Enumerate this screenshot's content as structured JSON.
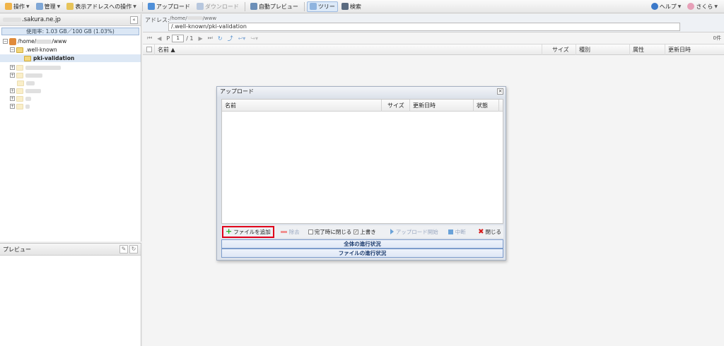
{
  "toolbar": {
    "operations": "操作",
    "manage": "管理",
    "address_ops": "表示アドレスへの操作",
    "upload": "アップロード",
    "download": "ダウンロード",
    "auto_preview": "自動プレビュー",
    "tree": "ツリー",
    "search": "検索",
    "help": "ヘルプ",
    "user": "さくら"
  },
  "left_panel": {
    "domain": ".sakura.ne.jp",
    "usage": "使用率: 1.03 GB／100 GB (1.03%)",
    "tree": {
      "root": "/home/",
      "root_suffix": "/www",
      "well_known": ".well-known",
      "pki_validation": "pki-validation"
    }
  },
  "preview": {
    "title": "プレビュー"
  },
  "address": {
    "label": "アドレス:",
    "path1": "/home/",
    "path1_suffix": "/www",
    "path2": "/.well-known/pki-validation"
  },
  "pager": {
    "page_prefix": "P",
    "page": "1",
    "total": "/ 1",
    "count": "0件"
  },
  "grid": {
    "name": "名前 ▲",
    "size": "サイズ",
    "type": "種別",
    "attr": "属性",
    "updated": "更新日時"
  },
  "dialog": {
    "title": "アップロード",
    "columns": {
      "name": "名前",
      "size": "サイズ",
      "updated": "更新日時",
      "status": "状態"
    },
    "toolbar": {
      "add_file": "ファイルを追加",
      "remove": "除去",
      "close_on_finish": "完了時に閉じる",
      "overwrite": "上書き",
      "start_upload": "アップロード開始",
      "abort": "中断",
      "close": "閉じる"
    },
    "progress_overall": "全体の進行状況",
    "progress_file": "ファイルの進行状況"
  },
  "colors": {
    "accent": "#e0001a",
    "selection": "#dde8f5",
    "folder": "#f2d67b"
  }
}
